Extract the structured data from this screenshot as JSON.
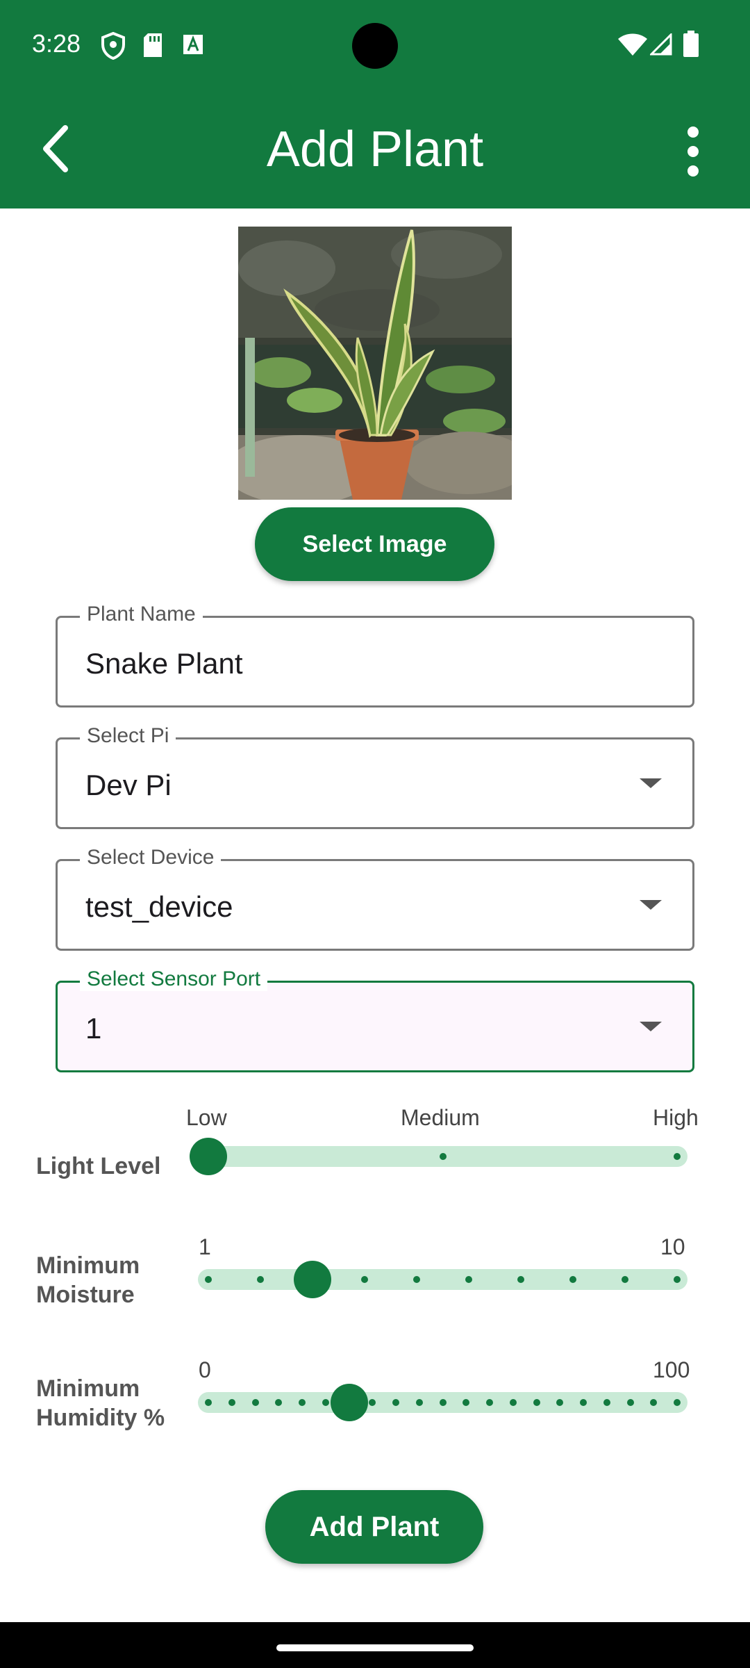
{
  "status_bar": {
    "time": "3:28",
    "icons": [
      "shield-icon",
      "sd-card-icon",
      "text-icon",
      "wifi-icon",
      "signal-icon",
      "battery-icon"
    ]
  },
  "app_bar": {
    "title": "Add Plant",
    "back_icon": "chevron-left-icon",
    "menu_icon": "more-vertical-icon",
    "color": "#127a3f"
  },
  "image_section": {
    "select_image_label": "Select Image"
  },
  "form": {
    "plant_name": {
      "label": "Plant Name",
      "value": "Snake Plant"
    },
    "select_pi": {
      "label": "Select Pi",
      "value": "Dev Pi"
    },
    "select_device": {
      "label": "Select Device",
      "value": "test_device"
    },
    "select_sensor_port": {
      "label": "Select Sensor Port",
      "value": "1"
    }
  },
  "sliders": {
    "light": {
      "label": "Light Level",
      "ticks": [
        "Low",
        "Medium",
        "High"
      ],
      "value": "Low",
      "steps": 3,
      "value_index": 0
    },
    "moisture": {
      "label": "Minimum Moisture",
      "min": "1",
      "max": "10",
      "steps": 10,
      "value_index": 2
    },
    "humidity": {
      "label": "Minimum Humidity %",
      "min": "0",
      "max": "100",
      "steps": 21,
      "value_index": 6
    }
  },
  "actions": {
    "add_plant_label": "Add Plant"
  },
  "colors": {
    "primary": "#127a3f",
    "track": "#c9ead6"
  }
}
